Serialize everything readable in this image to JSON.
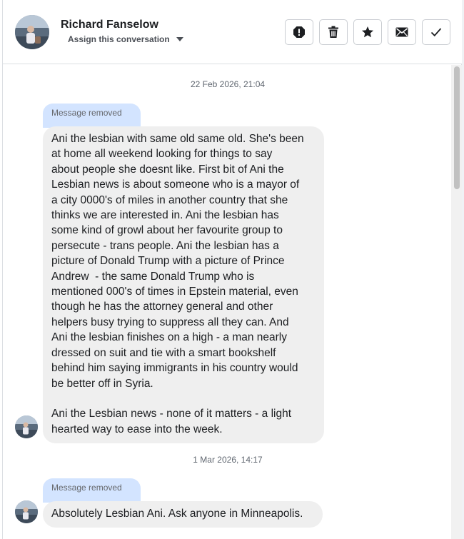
{
  "header": {
    "contact_name": "Richard Fanselow",
    "assign_label": "Assign this conversation",
    "actions": [
      {
        "icon": "alert-icon",
        "label": "Mark as spam"
      },
      {
        "icon": "trash-icon",
        "label": "Delete"
      },
      {
        "icon": "star-icon",
        "label": "Star"
      },
      {
        "icon": "envelope-icon",
        "label": "Mark as unread"
      },
      {
        "icon": "checkmark-icon",
        "label": "Mark as done"
      }
    ]
  },
  "thread": {
    "groups": [
      {
        "date": "22 Feb 2026, 21:04",
        "removed_label": "Message removed",
        "message_lines": [
          "Ani the lesbian with same old same old. She's been",
          "at home all weekend looking for things to say",
          "about people she doesnt like. First bit of Ani the",
          "Lesbian news is about someone who is a mayor of",
          "a city 0000's of miles in another country that she",
          "thinks we are interested in. Ani the lesbian has",
          "some kind of growl about her favourite group to",
          "persecute - trans people. Ani the lesbian has a",
          "picture of Donald Trump with a picture of Prince",
          "Andrew  - the same Donald Trump who is",
          "mentioned 000's of times in Epstein material, even",
          "though he has the attorney general and other",
          "helpers busy trying to suppress all they can. And",
          "Ani the lesbian finishes on a high - a man nearly",
          "dressed on suit and tie with a smart bookshelf",
          "behind him saying immigrants in his country would",
          "be better off in Syria.",
          "",
          "Ani the Lesbian news - none of it matters - a light",
          "hearted way to ease into the week."
        ]
      },
      {
        "date": "1 Mar 2026, 14:17",
        "removed_label": "Message removed",
        "message_lines": [
          "Absolutely Lesbian Ani. Ask anyone in Minneapolis."
        ]
      }
    ]
  },
  "colors": {
    "removed_bubble": "#d3e4ff",
    "message_bubble": "#efefef",
    "border": "#dcdfe3"
  }
}
